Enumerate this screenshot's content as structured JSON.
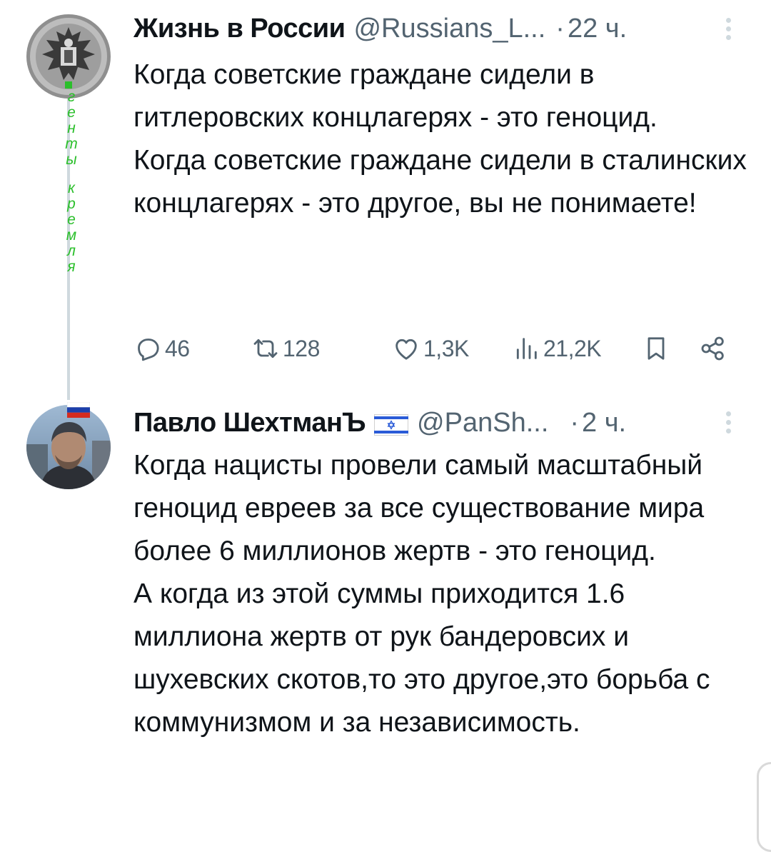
{
  "tweets": [
    {
      "author_name": "Жизнь в России",
      "author_handle": "@Russians_L...",
      "separator": "·",
      "time": "22 ч.",
      "avatar_overlay_letters": [
        "г",
        "е",
        "н",
        "т",
        "ы",
        "к",
        "р",
        "е",
        "м",
        "л",
        "я"
      ],
      "paragraphs": [
        "Когда советские граждане сидели в гитлеровских концлагерях - это геноцид.",
        "Когда советские граждане сидели в сталинских концлагерях - это другое, вы не понимаете!"
      ],
      "stats": {
        "replies": "46",
        "reposts": "128",
        "likes": "1,3K",
        "views": "21,2K"
      },
      "icons": [
        "reply-icon",
        "repost-icon",
        "like-icon",
        "views-icon",
        "bookmark-icon",
        "share-icon",
        "more-icon"
      ]
    },
    {
      "author_name": "Павло ШехтманЪ",
      "author_badge": "israel-flag-icon",
      "author_handle": "@PanSh...",
      "separator": "·",
      "time": "2 ч.",
      "paragraphs": [
        "Когда нацисты провели самый масштабный геноцид евреев за все существование мира более 6 миллионов жертв - это геноцид.",
        "А когда из этой суммы приходится 1.6 миллиона жертв от рук бандеровсих и шухевских скотов,то это другое,это борьба с коммунизмом и за независимость."
      ]
    }
  ],
  "colors": {
    "text": "#0f1419",
    "secondary": "#536471",
    "thread_line": "#cfd9de",
    "overlay_green": "#2bbf2b"
  }
}
